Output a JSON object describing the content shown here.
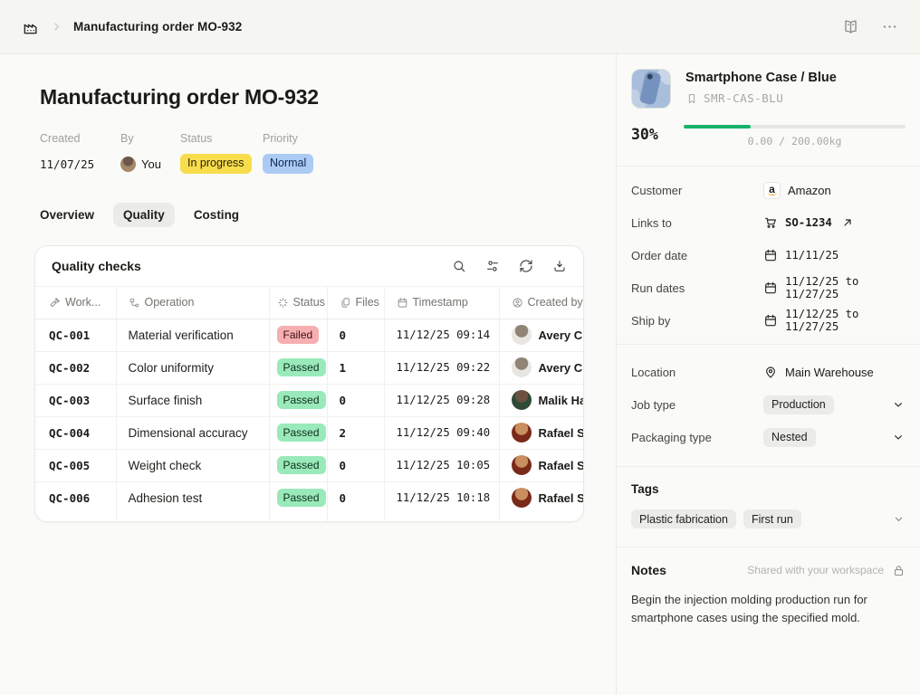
{
  "topbar": {
    "title": "Manufacturing order MO-932"
  },
  "header": {
    "title": "Manufacturing order MO-932",
    "meta": [
      {
        "label": "Created",
        "value": "11/07/25",
        "type": "date"
      },
      {
        "label": "By",
        "value": "You",
        "type": "avatar",
        "avatar": "you"
      },
      {
        "label": "Status",
        "value": "In progress",
        "type": "badge",
        "badge": "yellow"
      },
      {
        "label": "Priority",
        "value": "Normal",
        "type": "badge",
        "badge": "blue"
      }
    ]
  },
  "tabs": [
    {
      "label": "Overview",
      "active": false
    },
    {
      "label": "Quality",
      "active": true
    },
    {
      "label": "Costing",
      "active": false
    }
  ],
  "quality_card": {
    "title": "Quality checks",
    "toolbar": [
      {
        "name": "search",
        "icon": "search"
      },
      {
        "name": "view-settings",
        "icon": "sliders"
      },
      {
        "name": "refresh",
        "icon": "refresh"
      },
      {
        "name": "download",
        "icon": "download"
      }
    ],
    "columns": [
      {
        "label": "Work...",
        "icon": "hammer"
      },
      {
        "label": "Operation",
        "icon": "workflow"
      },
      {
        "label": "Status",
        "icon": "loader"
      },
      {
        "label": "Files",
        "icon": "files"
      },
      {
        "label": "Timestamp",
        "icon": "calendar"
      },
      {
        "label": "Created by",
        "icon": "person-circle"
      }
    ],
    "rows": [
      {
        "id": "QC-001",
        "operation": "Material verification",
        "status": "Failed",
        "files": "0",
        "timestamp": "11/12/25 09:14",
        "created_by": "Avery Che",
        "avatar": "avery"
      },
      {
        "id": "QC-002",
        "operation": "Color uniformity",
        "status": "Passed",
        "files": "1",
        "timestamp": "11/12/25 09:22",
        "created_by": "Avery Che",
        "avatar": "avery"
      },
      {
        "id": "QC-003",
        "operation": "Surface finish",
        "status": "Passed",
        "files": "0",
        "timestamp": "11/12/25 09:28",
        "created_by": "Malik Har",
        "avatar": "malik"
      },
      {
        "id": "QC-004",
        "operation": "Dimensional accuracy",
        "status": "Passed",
        "files": "2",
        "timestamp": "11/12/25 09:40",
        "created_by": "Rafael Sa",
        "avatar": "rafael"
      },
      {
        "id": "QC-005",
        "operation": "Weight check",
        "status": "Passed",
        "files": "0",
        "timestamp": "11/12/25 10:05",
        "created_by": "Rafael Sa",
        "avatar": "rafael"
      },
      {
        "id": "QC-006",
        "operation": "Adhesion test",
        "status": "Passed",
        "files": "0",
        "timestamp": "11/12/25 10:18",
        "created_by": "Rafael Sa",
        "avatar": "rafael"
      }
    ]
  },
  "side_panel": {
    "product": {
      "name": "Smartphone Case / Blue",
      "sku": "SMR-CAS-BLU",
      "progress_label": "30%",
      "progress_pct": 30,
      "progress_caption": "0.00 / 200.00kg"
    },
    "fields": [
      {
        "label": "Customer",
        "value": "Amazon",
        "icon": "amazon"
      },
      {
        "label": "Links to",
        "value": "SO-1234",
        "icon": "cart",
        "external": true
      },
      {
        "label": "Order date",
        "value": "11/11/25",
        "icon": "calendar"
      },
      {
        "label": "Run dates",
        "value": "11/12/25 to 11/27/25",
        "icon": "calendar"
      },
      {
        "label": "Ship by",
        "value": "11/12/25 to 11/27/25",
        "icon": "calendar"
      }
    ],
    "fields2": [
      {
        "label": "Location",
        "value": "Main Warehouse",
        "icon": "map-pin"
      },
      {
        "label": "Job type",
        "value": "Production",
        "type": "select"
      },
      {
        "label": "Packaging type",
        "value": "Nested",
        "type": "select"
      }
    ],
    "tags": {
      "title": "Tags",
      "items": [
        "Plastic fabrication",
        "First run"
      ]
    },
    "notes": {
      "title": "Notes",
      "shared_label": "Shared with your workspace",
      "body": "Begin the injection molding production run for smartphone cases using the specified mold."
    }
  },
  "colors": {
    "accent_green": "#17b26a",
    "badge_yellow": "#f8dd4d",
    "badge_blue": "#abcaf4",
    "badge_red": "#f6aeb1",
    "badge_green": "#9ae9ba",
    "avatars": {
      "you": [
        "#6e564a",
        "#a5876b"
      ],
      "avery": [
        "#8f8475",
        "#e8e6e1"
      ],
      "malik": [
        "#6b5140",
        "#2f4a35"
      ],
      "rafael": [
        "#c98f5f",
        "#7a2a18"
      ]
    }
  }
}
